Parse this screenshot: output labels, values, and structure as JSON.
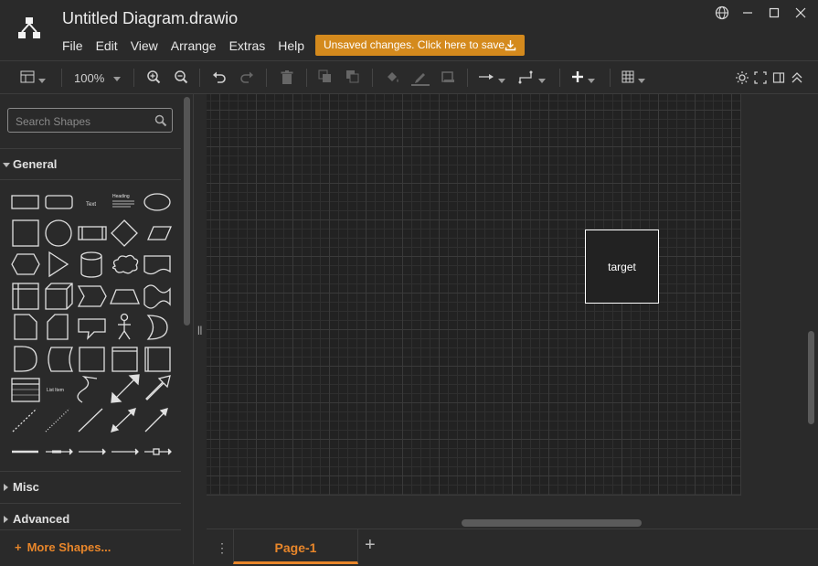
{
  "app": {
    "title": "Untitled Diagram.drawio",
    "save_notice": "Unsaved changes. Click here to save.",
    "menus": [
      "File",
      "Edit",
      "View",
      "Arrange",
      "Extras",
      "Help"
    ],
    "window_controls": [
      "globe-icon",
      "minimize-icon",
      "maximize-icon",
      "close-icon"
    ]
  },
  "toolbar": {
    "zoom": "100%",
    "icons": [
      "format-panel-icon",
      "zoom-in-icon",
      "zoom-out-icon",
      "undo-icon",
      "redo-icon",
      "delete-icon",
      "to-front-icon",
      "to-back-icon",
      "fill-color-icon",
      "line-color-icon",
      "shadow-icon",
      "connection-icon",
      "waypoints-icon",
      "insert-icon",
      "table-icon",
      "theme-icon",
      "fullscreen-icon",
      "toggle-panel-icon",
      "collapse-icon"
    ]
  },
  "sidebar": {
    "search_placeholder": "Search Shapes",
    "sections": [
      {
        "label": "General",
        "expanded": true
      },
      {
        "label": "Misc",
        "expanded": false
      },
      {
        "label": "Advanced",
        "expanded": false
      }
    ],
    "more_shapes": "More Shapes...",
    "text_shape_label": "Text",
    "heading_shape_label": "Heading",
    "list_shape_label": "List Item"
  },
  "canvas": {
    "shapes": [
      {
        "label": "target"
      }
    ]
  },
  "pages": {
    "tabs": [
      "Page-1"
    ]
  },
  "colors": {
    "accent": "#e8862a",
    "save_notice_bg": "#d48a1d",
    "background": "#2a2a2a"
  }
}
